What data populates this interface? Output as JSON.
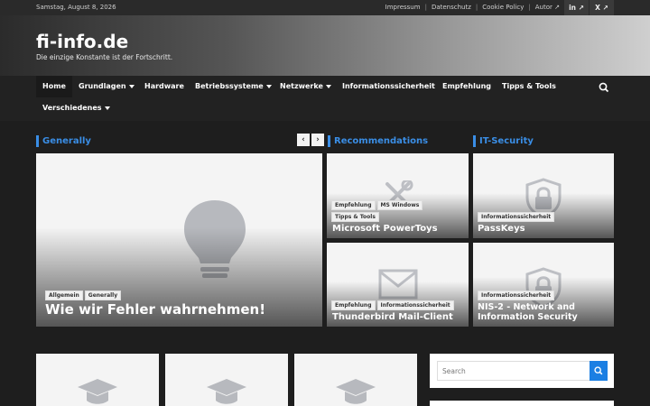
{
  "topbar": {
    "date": "Samstag, August 8, 2026",
    "links": [
      "Impressum",
      "Datenschutz",
      "Cookie Policy",
      "Autor"
    ],
    "social": [
      "in",
      "X"
    ]
  },
  "header": {
    "site_title": "fi-info.de",
    "tagline": "Die einzige Konstante ist der Fortschritt."
  },
  "nav": {
    "items": [
      "Home",
      "Grundlagen",
      "Hardware",
      "Betriebssysteme",
      "Netzwerke",
      "Informationssicherheit",
      "Empfehlung",
      "Tipps & Tools",
      "Verschiedenes"
    ]
  },
  "sections": {
    "generally": "Generally",
    "recommendations": "Recommendations",
    "it_security": "IT-Security"
  },
  "cards": {
    "featured": {
      "tags": [
        "Allgemein",
        "Generally"
      ],
      "title": "Wie wir Fehler wahrnehmen!",
      "icon": "lightbulb-icon"
    },
    "powertoys": {
      "tags": [
        "Empfehlung",
        "MS Windows",
        "Tipps & Tools"
      ],
      "title": "Microsoft PowerToys",
      "icon": "tools-icon"
    },
    "thunderbird": {
      "tags": [
        "Empfehlung",
        "Informationssicherheit"
      ],
      "title": "Thunderbird Mail-Client",
      "icon": "envelope-icon"
    },
    "passkeys": {
      "tags": [
        "Informationssicherheit"
      ],
      "title": "PassKeys",
      "icon": "shield-lock-icon"
    },
    "nis2": {
      "tags": [
        "Informationssicherheit"
      ],
      "title": "NIS-2 - Network and Information Security",
      "icon": "shield-lock-icon"
    }
  },
  "sidebar": {
    "search_placeholder": "Search"
  },
  "colors": {
    "accent": "#3a8ee6",
    "search_button": "#1b7fe3"
  }
}
